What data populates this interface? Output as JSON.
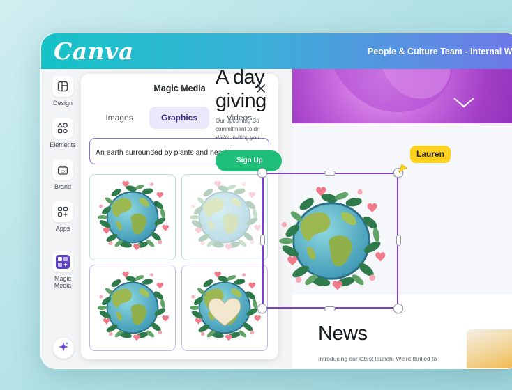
{
  "app": {
    "logo": "Canva",
    "project_title": "People & Culture Team - Internal Website"
  },
  "rail": {
    "items": [
      {
        "label": "Design",
        "icon": "layout-icon"
      },
      {
        "label": "Elements",
        "icon": "shapes-icon"
      },
      {
        "label": "Brand",
        "icon": "brand-kit-icon"
      },
      {
        "label": "Apps",
        "icon": "apps-icon"
      },
      {
        "label": "Magic\nMedia",
        "icon": "magic-media-icon"
      }
    ],
    "assistant_icon": "sparkle-icon"
  },
  "panel": {
    "title": "Magic Media",
    "tabs": [
      {
        "label": "Images",
        "active": false
      },
      {
        "label": "Graphics",
        "active": true
      },
      {
        "label": "Videos",
        "active": false
      }
    ],
    "prompt_value": "An earth surrounded by plants and hearts",
    "results": [
      {
        "name": "earth-graphic-1",
        "selected_style": "blue"
      },
      {
        "name": "earth-graphic-2-faded",
        "selected_style": "blue"
      },
      {
        "name": "earth-graphic-3",
        "selected_style": "purple"
      },
      {
        "name": "earth-graphic-4-heart",
        "selected_style": "purple"
      }
    ]
  },
  "canvas": {
    "hero_title_line1": "A day",
    "hero_title_line2": "giving",
    "hero_copy_line1": "Our upcoming Co",
    "hero_copy_line2": "commitment to dr",
    "hero_copy_line3": "We're inviting you",
    "signup_label": "Sign Up",
    "news_title": "News",
    "news_copy": "Introducing our latest launch. We're thrilled to",
    "collaborator_name": "Lauren"
  },
  "colors": {
    "accent": "#7d3bd8",
    "topbar_start": "#14c3c6",
    "topbar_end": "#6f78e8",
    "signup": "#1fbf7a",
    "collaborator": "#ffd21f"
  }
}
